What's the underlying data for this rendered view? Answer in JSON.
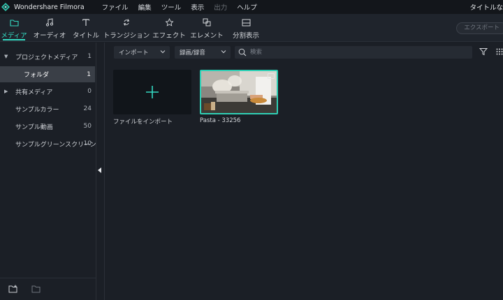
{
  "titlebar": {
    "app_name": "Wondershare Filmora",
    "menu": [
      {
        "label": "ファイル",
        "enabled": true
      },
      {
        "label": "編集",
        "enabled": true
      },
      {
        "label": "ツール",
        "enabled": true
      },
      {
        "label": "表示",
        "enabled": true
      },
      {
        "label": "出力",
        "enabled": false
      },
      {
        "label": "ヘルプ",
        "enabled": true
      }
    ],
    "project_title": "タイトルな"
  },
  "toolbar": {
    "tabs": [
      {
        "label": "メディア",
        "icon": "folder-icon",
        "active": true
      },
      {
        "label": "オーディオ",
        "icon": "music-note-icon",
        "active": false
      },
      {
        "label": "タイトル",
        "icon": "text-t-icon",
        "active": false
      },
      {
        "label": "トランジション",
        "icon": "transition-arrows-icon",
        "active": false
      },
      {
        "label": "エフェクト",
        "icon": "effects-star-icon",
        "active": false
      },
      {
        "label": "エレメント",
        "icon": "elements-icon",
        "active": false
      },
      {
        "label": "分割表示",
        "icon": "split-screen-icon",
        "active": false
      }
    ],
    "export_label": "エクスポート"
  },
  "sidebar": {
    "tree": [
      {
        "label": "プロジェクトメディア",
        "count": "1",
        "expanded": true,
        "level": 0
      },
      {
        "label": "フォルダ",
        "count": "1",
        "selected": true,
        "level": 1
      },
      {
        "label": "共有メディア",
        "count": "0",
        "expanded": false,
        "level": 0
      },
      {
        "label": "サンプルカラー",
        "count": "24",
        "level": 0
      },
      {
        "label": "サンプル動画",
        "count": "50",
        "level": 0
      },
      {
        "label": "サンプルグリーンスクリーン",
        "count": "10",
        "level": 0
      }
    ]
  },
  "library": {
    "import_dropdown": "インポート",
    "record_dropdown": "録画/録音",
    "search_placeholder": "検索",
    "items": [
      {
        "caption": "ファイルをインポート",
        "type": "import"
      },
      {
        "caption": "Pasta - 33256",
        "type": "video"
      }
    ]
  },
  "colors": {
    "accent": "#34d9c2",
    "background": "#1b1f26",
    "toolbar": "#1f242c",
    "titlebar": "#13161b"
  }
}
